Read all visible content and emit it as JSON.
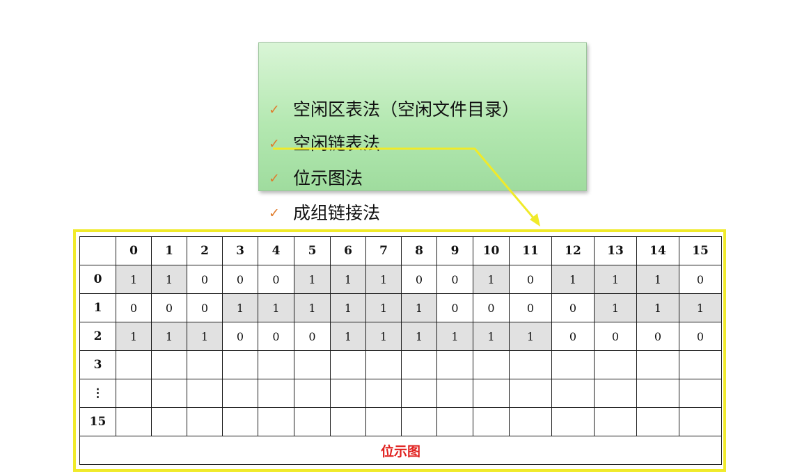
{
  "methods": [
    {
      "icon": "check-icon",
      "label": "空闲区表法（空闲文件目录）"
    },
    {
      "icon": "check-icon",
      "label": "空闲链表法"
    },
    {
      "icon": "check-icon",
      "label": "位示图法"
    },
    {
      "icon": "check-icon",
      "label": "成组链接法"
    }
  ],
  "check_glyph": "✓",
  "colors": {
    "methods_bg": "#b4e8b1",
    "check": "#e07b2a",
    "pointer": "#f0ea2a",
    "frame": "#f0ea2a",
    "shaded_cell": "#e1e1e1",
    "caption": "#e0201e"
  },
  "bitmap": {
    "column_headers": [
      "0",
      "1",
      "2",
      "3",
      "4",
      "5",
      "6",
      "7",
      "8",
      "9",
      "10",
      "11",
      "12",
      "13",
      "14",
      "15"
    ],
    "rows": [
      {
        "label": "0",
        "bits": [
          "1",
          "1",
          "0",
          "0",
          "0",
          "1",
          "1",
          "1",
          "0",
          "0",
          "1",
          "0",
          "1",
          "1",
          "1",
          "0"
        ],
        "shaded": [
          true,
          true,
          false,
          false,
          false,
          true,
          true,
          true,
          false,
          false,
          true,
          false,
          true,
          true,
          true,
          false
        ]
      },
      {
        "label": "1",
        "bits": [
          "0",
          "0",
          "0",
          "1",
          "1",
          "1",
          "1",
          "1",
          "1",
          "0",
          "0",
          "0",
          "0",
          "1",
          "1",
          "1"
        ],
        "shaded": [
          false,
          false,
          false,
          true,
          true,
          true,
          true,
          true,
          true,
          false,
          false,
          false,
          false,
          true,
          true,
          true
        ]
      },
      {
        "label": "2",
        "bits": [
          "1",
          "1",
          "1",
          "0",
          "0",
          "0",
          "1",
          "1",
          "1",
          "1",
          "1",
          "1",
          "0",
          "0",
          "0",
          "0"
        ],
        "shaded": [
          true,
          true,
          true,
          false,
          false,
          false,
          true,
          true,
          true,
          true,
          true,
          true,
          false,
          false,
          false,
          false
        ]
      },
      {
        "label": "3",
        "bits": [
          "",
          "",
          "",
          "",
          "",
          "",
          "",
          "",
          "",
          "",
          "",
          "",
          "",
          "",
          "",
          ""
        ],
        "shaded": [
          false,
          false,
          false,
          false,
          false,
          false,
          false,
          false,
          false,
          false,
          false,
          false,
          false,
          false,
          false,
          false
        ]
      },
      {
        "label": "⋮",
        "bits": [
          "",
          "",
          "",
          "",
          "",
          "",
          "",
          "",
          "",
          "",
          "",
          "",
          "",
          "",
          "",
          ""
        ],
        "shaded": [
          false,
          false,
          false,
          false,
          false,
          false,
          false,
          false,
          false,
          false,
          false,
          false,
          false,
          false,
          false,
          false
        ]
      },
      {
        "label": "15",
        "bits": [
          "",
          "",
          "",
          "",
          "",
          "",
          "",
          "",
          "",
          "",
          "",
          "",
          "",
          "",
          "",
          ""
        ],
        "shaded": [
          false,
          false,
          false,
          false,
          false,
          false,
          false,
          false,
          false,
          false,
          false,
          false,
          false,
          false,
          false,
          false
        ]
      }
    ],
    "caption": "位示图"
  }
}
